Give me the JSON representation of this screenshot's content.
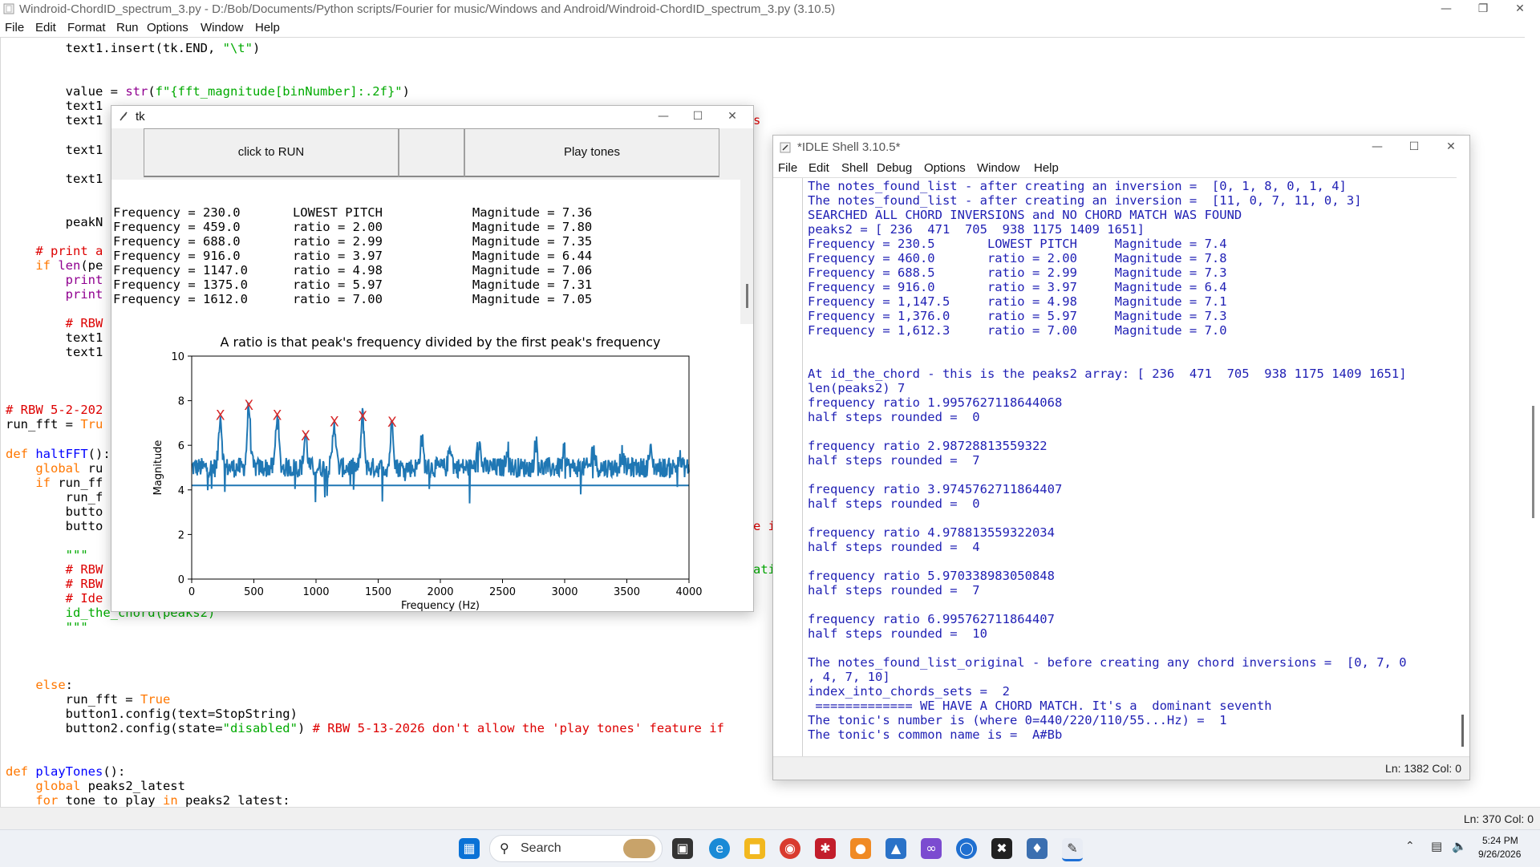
{
  "editor": {
    "title": "Windroid-ChordID_spectrum_3.py - D:/Bob/Documents/Python scripts/Fourier for music/Windows and Android/Windroid-ChordID_spectrum_3.py (3.10.5)",
    "menu": [
      "File",
      "Edit",
      "Format",
      "Run",
      "Options",
      "Window",
      "Help"
    ],
    "code_lines": [
      {
        "y": 60,
        "parts": [
          {
            "t": "        text1.insert(tk.END, ",
            "c": ""
          },
          {
            "t": "\"\\t\"",
            "c": "str"
          },
          {
            "t": ")",
            "c": ""
          }
        ]
      },
      {
        "y": 114,
        "parts": [
          {
            "t": "        value = ",
            "c": ""
          },
          {
            "t": "str",
            "c": "bi"
          },
          {
            "t": "(",
            "c": ""
          },
          {
            "t": "f\"{fft_magnitude[binNumber]:.2f}\"",
            "c": "str"
          },
          {
            "t": ")",
            "c": ""
          }
        ]
      },
      {
        "y": 132,
        "parts": [
          {
            "t": "        text1",
            "c": ""
          }
        ]
      },
      {
        "y": 150,
        "parts": [
          {
            "t": "        text1",
            "c": ""
          }
        ]
      },
      {
        "y": 187,
        "parts": [
          {
            "t": "        text1",
            "c": ""
          }
        ]
      },
      {
        "y": 223,
        "parts": [
          {
            "t": "        text1",
            "c": ""
          }
        ]
      },
      {
        "y": 277,
        "parts": [
          {
            "t": "        peakN",
            "c": ""
          }
        ]
      },
      {
        "y": 313,
        "parts": [
          {
            "t": "    ",
            "c": ""
          },
          {
            "t": "# print a",
            "c": "cm"
          }
        ]
      },
      {
        "y": 331,
        "parts": [
          {
            "t": "    ",
            "c": ""
          },
          {
            "t": "if",
            "c": "kw"
          },
          {
            "t": " ",
            "c": ""
          },
          {
            "t": "len",
            "c": "bi"
          },
          {
            "t": "(pe",
            "c": ""
          }
        ]
      },
      {
        "y": 349,
        "parts": [
          {
            "t": "        ",
            "c": ""
          },
          {
            "t": "print",
            "c": "bi"
          }
        ]
      },
      {
        "y": 367,
        "parts": [
          {
            "t": "        ",
            "c": ""
          },
          {
            "t": "print",
            "c": "bi"
          }
        ]
      },
      {
        "y": 403,
        "parts": [
          {
            "t": "        ",
            "c": ""
          },
          {
            "t": "# RBW",
            "c": "cm"
          }
        ]
      },
      {
        "y": 421,
        "parts": [
          {
            "t": "        text1",
            "c": ""
          }
        ]
      },
      {
        "y": 439,
        "parts": [
          {
            "t": "        text1",
            "c": ""
          }
        ]
      },
      {
        "y": 511,
        "parts": [
          {
            "t": "# RBW 5-2-202",
            "c": "cm"
          }
        ]
      },
      {
        "y": 529,
        "parts": [
          {
            "t": "run_fft = ",
            "c": ""
          },
          {
            "t": "Tru",
            "c": "kw"
          }
        ]
      },
      {
        "y": 566,
        "parts": [
          {
            "t": "def",
            "c": "kw"
          },
          {
            "t": " ",
            "c": ""
          },
          {
            "t": "haltFFT",
            "c": "def"
          },
          {
            "t": "():",
            "c": ""
          }
        ]
      },
      {
        "y": 584,
        "parts": [
          {
            "t": "    ",
            "c": ""
          },
          {
            "t": "global",
            "c": "kw"
          },
          {
            "t": " ru",
            "c": ""
          }
        ]
      },
      {
        "y": 602,
        "parts": [
          {
            "t": "    ",
            "c": ""
          },
          {
            "t": "if",
            "c": "kw"
          },
          {
            "t": " run_ff",
            "c": ""
          }
        ]
      },
      {
        "y": 620,
        "parts": [
          {
            "t": "        run_f",
            "c": ""
          }
        ]
      },
      {
        "y": 638,
        "parts": [
          {
            "t": "        butto",
            "c": ""
          }
        ]
      },
      {
        "y": 656,
        "parts": [
          {
            "t": "        butto",
            "c": ""
          }
        ]
      },
      {
        "y": 692,
        "parts": [
          {
            "t": "        ",
            "c": ""
          },
          {
            "t": "\"\"\"",
            "c": "str"
          }
        ]
      },
      {
        "y": 710,
        "parts": [
          {
            "t": "        ",
            "c": ""
          },
          {
            "t": "# RBW",
            "c": "cm"
          }
        ]
      },
      {
        "y": 728,
        "parts": [
          {
            "t": "        ",
            "c": ""
          },
          {
            "t": "# RBW",
            "c": "cm"
          }
        ]
      },
      {
        "y": 746,
        "parts": [
          {
            "t": "        ",
            "c": ""
          },
          {
            "t": "# Ide",
            "c": "cm"
          }
        ]
      },
      {
        "y": 764,
        "parts": [
          {
            "t": "        id_the_chord(peaks2)",
            "c": "str"
          }
        ]
      },
      {
        "y": 782,
        "parts": [
          {
            "t": "        ",
            "c": ""
          },
          {
            "t": "\"\"\"",
            "c": "str"
          }
        ]
      },
      {
        "y": 854,
        "parts": [
          {
            "t": "    ",
            "c": ""
          },
          {
            "t": "else",
            "c": "kw"
          },
          {
            "t": ":",
            "c": ""
          }
        ]
      },
      {
        "y": 872,
        "parts": [
          {
            "t": "        run_fft = ",
            "c": ""
          },
          {
            "t": "True",
            "c": "kw"
          }
        ]
      },
      {
        "y": 890,
        "parts": [
          {
            "t": "        button1.config(text=StopString)",
            "c": ""
          }
        ]
      },
      {
        "y": 908,
        "parts": [
          {
            "t": "        button2.config(state=",
            "c": ""
          },
          {
            "t": "\"disabled\"",
            "c": "str"
          },
          {
            "t": ") ",
            "c": ""
          },
          {
            "t": "# RBW 5-13-2026 don't allow the 'play tones' feature if",
            "c": "cm"
          }
        ]
      },
      {
        "y": 962,
        "parts": [
          {
            "t": "def",
            "c": "kw"
          },
          {
            "t": " ",
            "c": ""
          },
          {
            "t": "playTones",
            "c": "def"
          },
          {
            "t": "():",
            "c": ""
          }
        ]
      },
      {
        "y": 980,
        "parts": [
          {
            "t": "    ",
            "c": ""
          },
          {
            "t": "global",
            "c": "kw"
          },
          {
            "t": " peaks2_latest",
            "c": ""
          }
        ]
      },
      {
        "y": 998,
        "parts": [
          {
            "t": "    ",
            "c": ""
          },
          {
            "t": "for",
            "c": "kw"
          },
          {
            "t": " tone_to_play ",
            "c": ""
          },
          {
            "t": "in",
            "c": "kw"
          },
          {
            "t": " peaks2_latest:",
            "c": ""
          }
        ]
      }
    ],
    "peek_fragments": [
      {
        "x": 938,
        "y": 150,
        "text": "s",
        "c": "cm"
      },
      {
        "x": 938,
        "y": 656,
        "text": "e i",
        "c": "cm"
      },
      {
        "x": 938,
        "y": 710,
        "text": "ati",
        "c": "str"
      }
    ],
    "status": "Ln: 370   Col: 0"
  },
  "tk": {
    "title": "tk",
    "button_run": "click to RUN",
    "button_play": "Play tones",
    "lines": [
      "Frequency = 230.0       LOWEST PITCH            Magnitude = 7.36",
      "Frequency = 459.0       ratio = 2.00            Magnitude = 7.80",
      "Frequency = 688.0       ratio = 2.99            Magnitude = 7.35",
      "Frequency = 916.0       ratio = 3.97            Magnitude = 6.44",
      "Frequency = 1147.0      ratio = 4.98            Magnitude = 7.06",
      "Frequency = 1375.0      ratio = 5.97            Magnitude = 7.31",
      "Frequency = 1612.0      ratio = 7.00            Magnitude = 7.05"
    ]
  },
  "chart_data": {
    "type": "line",
    "title": "A ratio is that peak's frequency divided by the first peak's frequency",
    "xlabel": "Frequency (Hz)",
    "ylabel": "Magnitude",
    "xlim": [
      0,
      4000
    ],
    "ylim": [
      0,
      10
    ],
    "xticks": [
      0,
      500,
      1000,
      1500,
      2000,
      2500,
      3000,
      3500,
      4000
    ],
    "yticks": [
      0,
      2,
      4,
      6,
      8,
      10
    ],
    "series_color": "#1f77b4",
    "marker_color": "#d62728",
    "marker_label": "X",
    "baseline": 4.2,
    "noise_floor": 5.0,
    "harmonic_peaks": [
      {
        "x": 230,
        "y": 7.36
      },
      {
        "x": 459,
        "y": 7.8
      },
      {
        "x": 688,
        "y": 7.35
      },
      {
        "x": 916,
        "y": 6.44
      },
      {
        "x": 1147,
        "y": 7.06
      },
      {
        "x": 1375,
        "y": 7.31
      },
      {
        "x": 1612,
        "y": 7.05
      }
    ],
    "other_peaks": [
      {
        "x": 1850,
        "y": 6.3
      },
      {
        "x": 2080,
        "y": 6.0
      },
      {
        "x": 2310,
        "y": 6.2
      },
      {
        "x": 2540,
        "y": 5.9
      },
      {
        "x": 2770,
        "y": 6.1
      },
      {
        "x": 3000,
        "y": 5.8
      },
      {
        "x": 3230,
        "y": 5.9
      },
      {
        "x": 3460,
        "y": 5.6
      },
      {
        "x": 3690,
        "y": 5.7
      },
      {
        "x": 3920,
        "y": 5.5
      }
    ]
  },
  "shell": {
    "title": "*IDLE Shell 3.10.5*",
    "menu": [
      "File",
      "Edit",
      "Shell",
      "Debug",
      "Options",
      "Window",
      "Help"
    ],
    "lines": [
      "The notes_found_list - after creating an inversion =  [0, 1, 8, 0, 1, 4]",
      "The notes_found_list - after creating an inversion =  [11, 0, 7, 11, 0, 3]",
      "SEARCHED ALL CHORD INVERSIONS and NO CHORD MATCH WAS FOUND",
      "peaks2 = [ 236  471  705  938 1175 1409 1651]",
      "Frequency = 230.5       LOWEST PITCH     Magnitude = 7.4",
      "Frequency = 460.0       ratio = 2.00     Magnitude = 7.8",
      "Frequency = 688.5       ratio = 2.99     Magnitude = 7.3",
      "Frequency = 916.0       ratio = 3.97     Magnitude = 6.4",
      "Frequency = 1,147.5     ratio = 4.98     Magnitude = 7.1",
      "Frequency = 1,376.0     ratio = 5.97     Magnitude = 7.3",
      "Frequency = 1,612.3     ratio = 7.00     Magnitude = 7.0",
      "",
      "",
      "At id_the_chord - this is the peaks2 array: [ 236  471  705  938 1175 1409 1651]",
      "len(peaks2) 7",
      "frequency ratio 1.9957627118644068",
      "half steps rounded =  0",
      "",
      "frequency ratio 2.98728813559322",
      "half steps rounded =  7",
      "",
      "frequency ratio 3.9745762711864407",
      "half steps rounded =  0",
      "",
      "frequency ratio 4.978813559322034",
      "half steps rounded =  4",
      "",
      "frequency ratio 5.970338983050848",
      "half steps rounded =  7",
      "",
      "frequency ratio 6.995762711864407",
      "half steps rounded =  10",
      "",
      "The notes_found_list_original - before creating any chord inversions =  [0, 7, 0",
      ", 4, 7, 10]",
      "index_into_chords_sets =  2",
      " ============= WE HAVE A CHORD MATCH. It's a  dominant seventh",
      "The tonic's number is (where 0=440/220/110/55...Hz) =  1",
      "The tonic's common name is =  A#Bb"
    ],
    "status": "Ln: 1382   Col: 0"
  },
  "taskbar": {
    "search": "Search",
    "time": "5:24 PM",
    "date": "9/26/2026"
  }
}
